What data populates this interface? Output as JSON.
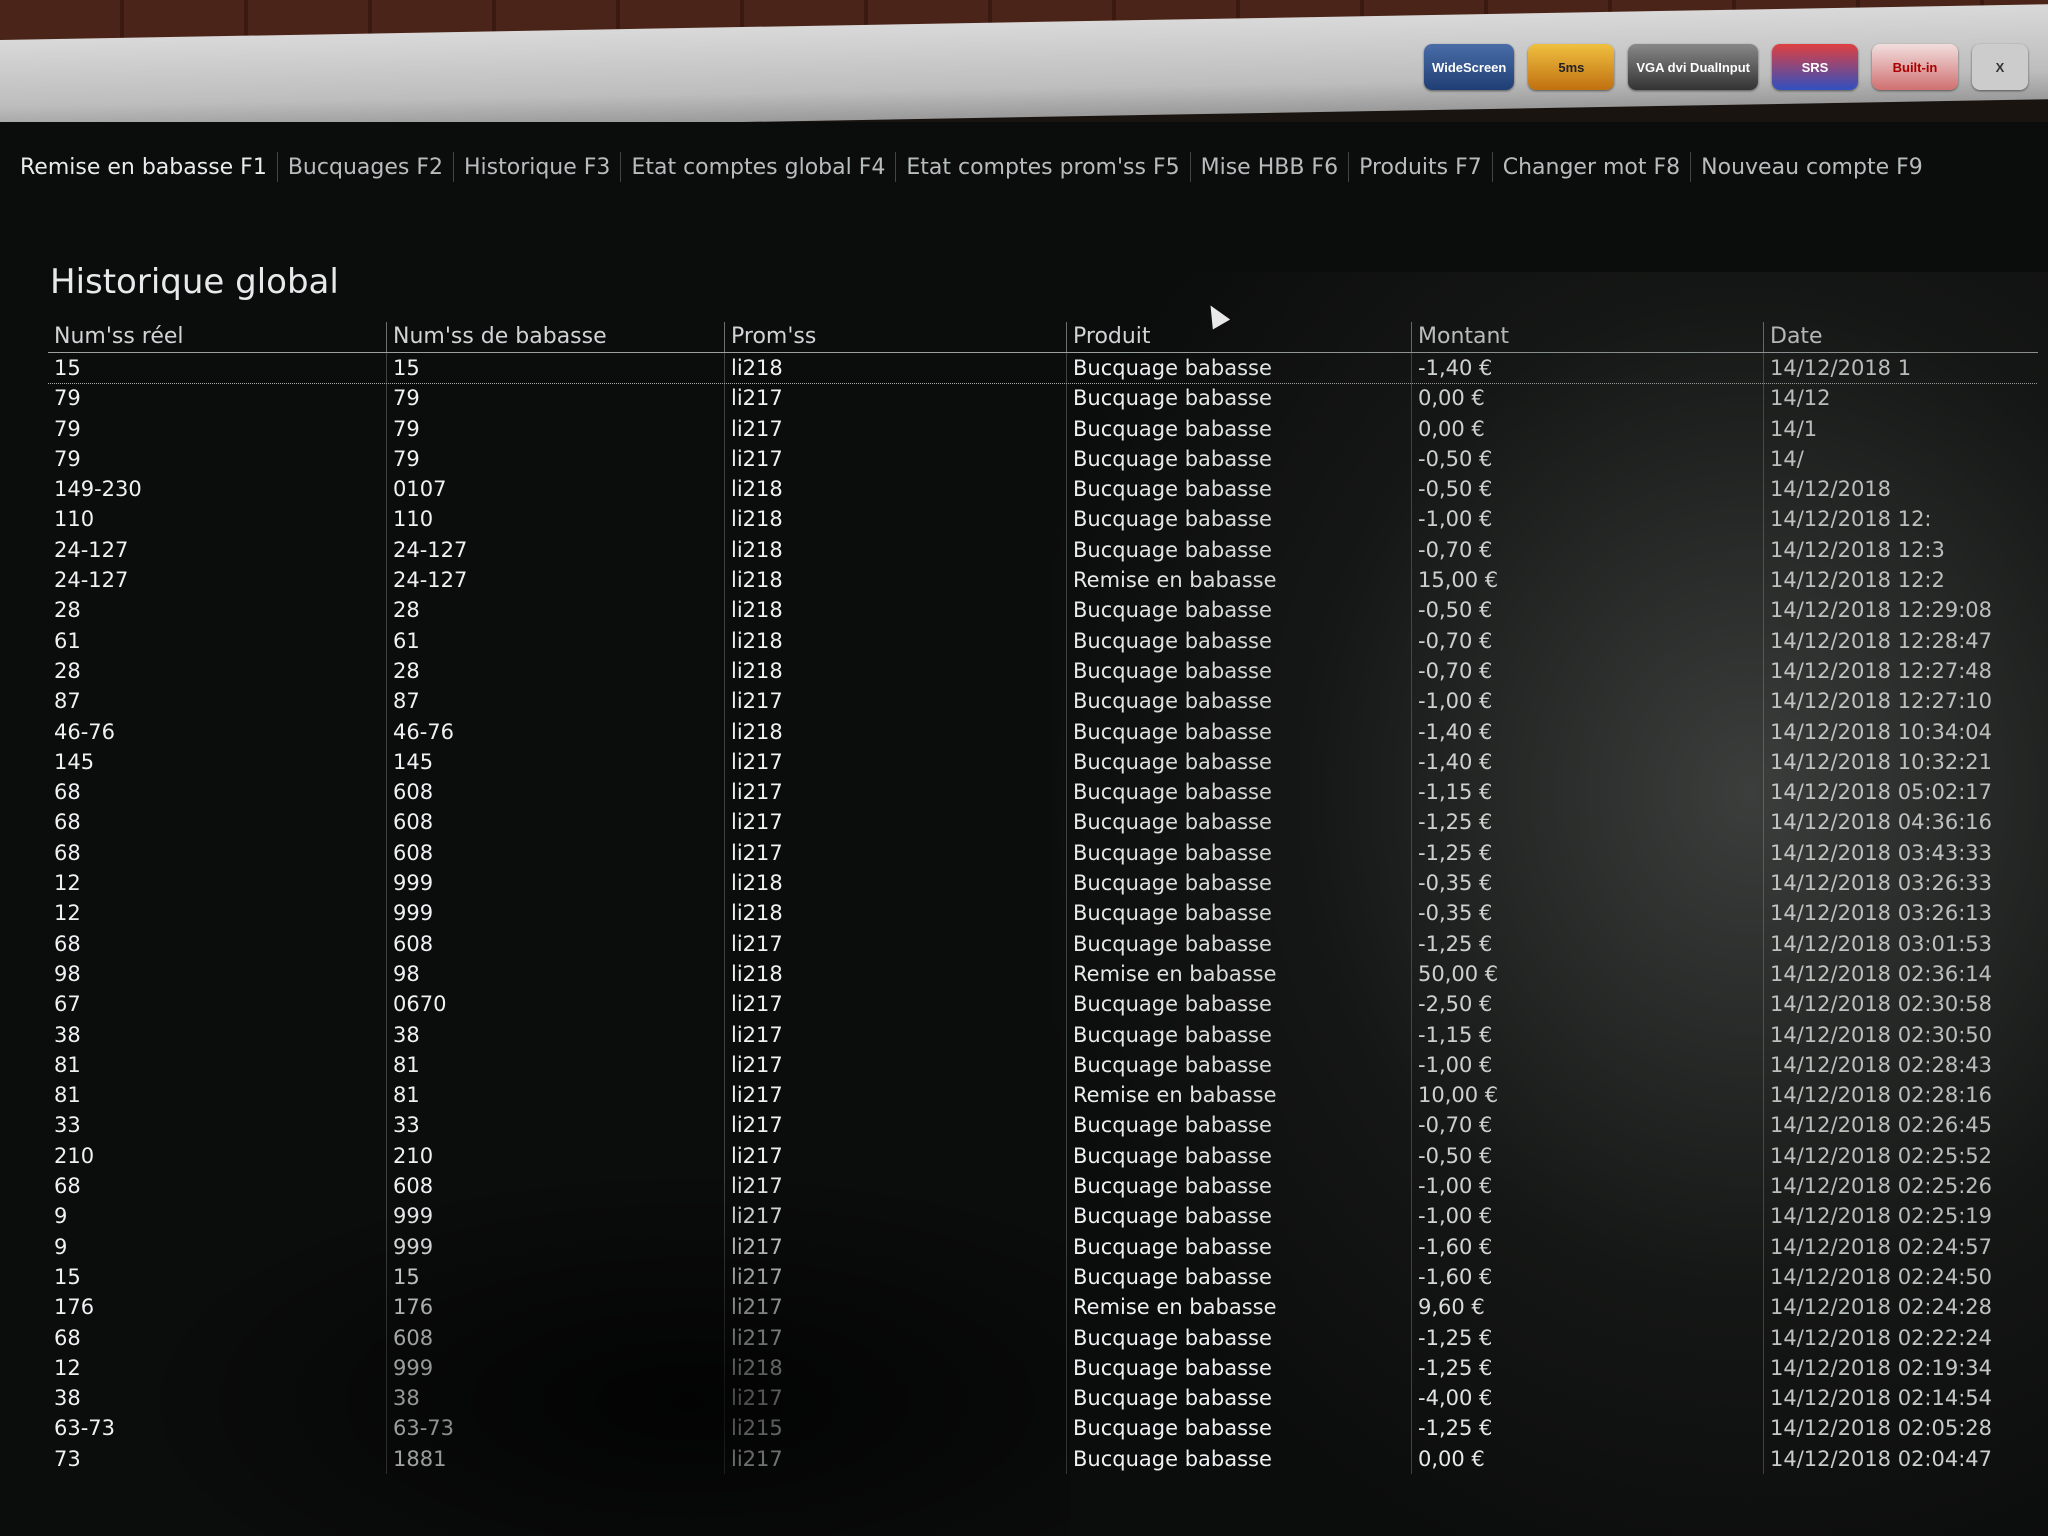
{
  "bezel_badges": [
    "WideScreen",
    "5ms",
    "VGA dvi DualInput",
    "SRS",
    "Built-in",
    "X"
  ],
  "menu": {
    "items": [
      {
        "label": "Remise en babasse F1",
        "active": true
      },
      {
        "label": "Bucquages F2",
        "active": false
      },
      {
        "label": "Historique F3",
        "active": false
      },
      {
        "label": "Etat comptes global F4",
        "active": false
      },
      {
        "label": "Etat comptes prom'ss F5",
        "active": false
      },
      {
        "label": "Mise HBB F6",
        "active": false
      },
      {
        "label": "Produits F7",
        "active": false
      },
      {
        "label": "Changer mot F8",
        "active": false
      },
      {
        "label": "Nouveau compte F9",
        "active": false
      }
    ]
  },
  "page_title": "Historique global",
  "table": {
    "columns": [
      "Num'ss réel",
      "Num'ss de babasse",
      "Prom'ss",
      "Produit",
      "Montant",
      "Date"
    ],
    "rows": [
      [
        "15",
        "15",
        "li218",
        "Bucquage babasse",
        "-1,40 €",
        "14/12/2018 1"
      ],
      [
        "79",
        "79",
        "li217",
        "Bucquage babasse",
        "0,00 €",
        "14/12"
      ],
      [
        "79",
        "79",
        "li217",
        "Bucquage babasse",
        "0,00 €",
        "14/1"
      ],
      [
        "79",
        "79",
        "li217",
        "Bucquage babasse",
        "-0,50 €",
        "14/"
      ],
      [
        "149-230",
        "0107",
        "li218",
        "Bucquage babasse",
        "-0,50 €",
        "14/12/2018"
      ],
      [
        "110",
        "110",
        "li218",
        "Bucquage babasse",
        "-1,00 €",
        "14/12/2018 12:"
      ],
      [
        "24-127",
        "24-127",
        "li218",
        "Bucquage babasse",
        "-0,70 €",
        "14/12/2018 12:3"
      ],
      [
        "24-127",
        "24-127",
        "li218",
        "Remise en babasse",
        "15,00 €",
        "14/12/2018 12:2"
      ],
      [
        "28",
        "28",
        "li218",
        "Bucquage babasse",
        "-0,50 €",
        "14/12/2018 12:29:08"
      ],
      [
        "61",
        "61",
        "li218",
        "Bucquage babasse",
        "-0,70 €",
        "14/12/2018 12:28:47"
      ],
      [
        "28",
        "28",
        "li218",
        "Bucquage babasse",
        "-0,70 €",
        "14/12/2018 12:27:48"
      ],
      [
        "87",
        "87",
        "li217",
        "Bucquage babasse",
        "-1,00 €",
        "14/12/2018 12:27:10"
      ],
      [
        "46-76",
        "46-76",
        "li218",
        "Bucquage babasse",
        "-1,40 €",
        "14/12/2018 10:34:04"
      ],
      [
        "145",
        "145",
        "li217",
        "Bucquage babasse",
        "-1,40 €",
        "14/12/2018 10:32:21"
      ],
      [
        "68",
        "608",
        "li217",
        "Bucquage babasse",
        "-1,15 €",
        "14/12/2018 05:02:17"
      ],
      [
        "68",
        "608",
        "li217",
        "Bucquage babasse",
        "-1,25 €",
        "14/12/2018 04:36:16"
      ],
      [
        "68",
        "608",
        "li217",
        "Bucquage babasse",
        "-1,25 €",
        "14/12/2018 03:43:33"
      ],
      [
        "12",
        "999",
        "li218",
        "Bucquage babasse",
        "-0,35 €",
        "14/12/2018 03:26:33"
      ],
      [
        "12",
        "999",
        "li218",
        "Bucquage babasse",
        "-0,35 €",
        "14/12/2018 03:26:13"
      ],
      [
        "68",
        "608",
        "li217",
        "Bucquage babasse",
        "-1,25 €",
        "14/12/2018 03:01:53"
      ],
      [
        "98",
        "98",
        "li218",
        "Remise en babasse",
        "50,00 €",
        "14/12/2018 02:36:14"
      ],
      [
        "67",
        "0670",
        "li217",
        "Bucquage babasse",
        "-2,50 €",
        "14/12/2018 02:30:58"
      ],
      [
        "38",
        "38",
        "li217",
        "Bucquage babasse",
        "-1,15 €",
        "14/12/2018 02:30:50"
      ],
      [
        "81",
        "81",
        "li217",
        "Bucquage babasse",
        "-1,00 €",
        "14/12/2018 02:28:43"
      ],
      [
        "81",
        "81",
        "li217",
        "Remise en babasse",
        "10,00 €",
        "14/12/2018 02:28:16"
      ],
      [
        "33",
        "33",
        "li217",
        "Bucquage babasse",
        "-0,70 €",
        "14/12/2018 02:26:45"
      ],
      [
        "210",
        "210",
        "li217",
        "Bucquage babasse",
        "-0,50 €",
        "14/12/2018 02:25:52"
      ],
      [
        "68",
        "608",
        "li217",
        "Bucquage babasse",
        "-1,00 €",
        "14/12/2018 02:25:26"
      ],
      [
        "9",
        "999",
        "li217",
        "Bucquage babasse",
        "-1,00 €",
        "14/12/2018 02:25:19"
      ],
      [
        "9",
        "999",
        "li217",
        "Bucquage babasse",
        "-1,60 €",
        "14/12/2018 02:24:57"
      ],
      [
        "15",
        "15",
        "li217",
        "Bucquage babasse",
        "-1,60 €",
        "14/12/2018 02:24:50"
      ],
      [
        "176",
        "176",
        "li217",
        "Remise en babasse",
        "9,60 €",
        "14/12/2018 02:24:28"
      ],
      [
        "68",
        "608",
        "li217",
        "Bucquage babasse",
        "-1,25 €",
        "14/12/2018 02:22:24"
      ],
      [
        "12",
        "999",
        "li218",
        "Bucquage babasse",
        "-1,25 €",
        "14/12/2018 02:19:34"
      ],
      [
        "38",
        "38",
        "li217",
        "Bucquage babasse",
        "-4,00 €",
        "14/12/2018 02:14:54"
      ],
      [
        "63-73",
        "63-73",
        "li215",
        "Bucquage babasse",
        "-1,25 €",
        "14/12/2018 02:05:28"
      ],
      [
        "73",
        "1881",
        "li217",
        "Bucquage babasse",
        "0,00 €",
        "14/12/2018 02:04:47"
      ]
    ]
  }
}
